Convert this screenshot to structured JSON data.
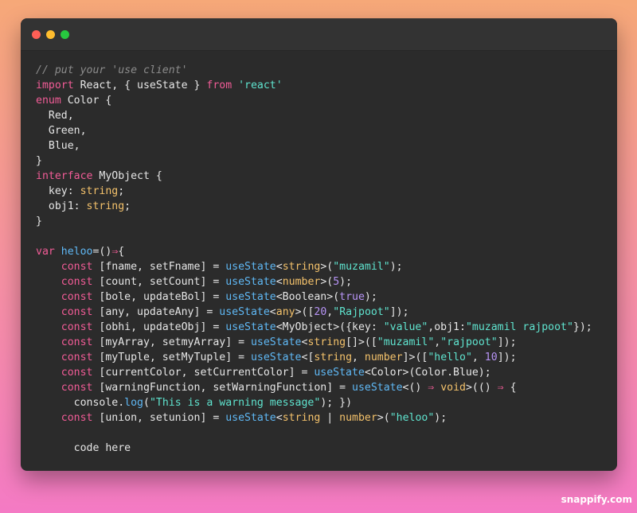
{
  "window": {
    "controls": [
      {
        "name": "close",
        "color": "#ff5f56"
      },
      {
        "name": "minimize",
        "color": "#ffbd2e"
      },
      {
        "name": "maximize",
        "color": "#27c93f"
      }
    ]
  },
  "code": {
    "lines": [
      [
        [
          "comment",
          "// put your 'use client'"
        ]
      ],
      [
        [
          "keyword",
          "import"
        ],
        [
          "plain",
          " React, { useState } "
        ],
        [
          "keyword",
          "from"
        ],
        [
          "plain",
          " "
        ],
        [
          "string",
          "'react'"
        ]
      ],
      [
        [
          "keyword",
          "enum"
        ],
        [
          "plain",
          " Color {"
        ]
      ],
      [
        [
          "plain",
          "  Red,"
        ]
      ],
      [
        [
          "plain",
          "  Green,"
        ]
      ],
      [
        [
          "plain",
          "  Blue,"
        ]
      ],
      [
        [
          "plain",
          "}"
        ]
      ],
      [
        [
          "keyword",
          "interface"
        ],
        [
          "plain",
          " MyObject {"
        ]
      ],
      [
        [
          "plain",
          "  key: "
        ],
        [
          "type",
          "string"
        ],
        [
          "plain",
          ";"
        ]
      ],
      [
        [
          "plain",
          "  obj1: "
        ],
        [
          "type",
          "string"
        ],
        [
          "plain",
          ";"
        ]
      ],
      [
        [
          "plain",
          "}"
        ]
      ],
      [],
      [
        [
          "keyword",
          "var"
        ],
        [
          "plain",
          " "
        ],
        [
          "func",
          "heloo"
        ],
        [
          "plain",
          "=()"
        ],
        [
          "keyword",
          "⇒"
        ],
        [
          "plain",
          "{"
        ]
      ],
      [
        [
          "plain",
          "    "
        ],
        [
          "keyword",
          "const"
        ],
        [
          "plain",
          " [fname, setFname] = "
        ],
        [
          "func",
          "useState"
        ],
        [
          "plain",
          "<"
        ],
        [
          "type",
          "string"
        ],
        [
          "plain",
          ">("
        ],
        [
          "string",
          "\"muzamil\""
        ],
        [
          "plain",
          ");"
        ]
      ],
      [
        [
          "plain",
          "    "
        ],
        [
          "keyword",
          "const"
        ],
        [
          "plain",
          " [count, setCount] = "
        ],
        [
          "func",
          "useState"
        ],
        [
          "plain",
          "<"
        ],
        [
          "type",
          "number"
        ],
        [
          "plain",
          ">("
        ],
        [
          "number",
          "5"
        ],
        [
          "plain",
          ");"
        ]
      ],
      [
        [
          "plain",
          "    "
        ],
        [
          "keyword",
          "const"
        ],
        [
          "plain",
          " [bole, updateBol] = "
        ],
        [
          "func",
          "useState"
        ],
        [
          "plain",
          "<Boolean>("
        ],
        [
          "const",
          "true"
        ],
        [
          "plain",
          ");"
        ]
      ],
      [
        [
          "plain",
          "    "
        ],
        [
          "keyword",
          "const"
        ],
        [
          "plain",
          " [any, updateAny] = "
        ],
        [
          "func",
          "useState"
        ],
        [
          "plain",
          "<"
        ],
        [
          "type",
          "any"
        ],
        [
          "plain",
          ">(["
        ],
        [
          "number",
          "20"
        ],
        [
          "plain",
          ","
        ],
        [
          "string",
          "\"Rajpoot\""
        ],
        [
          "plain",
          "]);"
        ]
      ],
      [
        [
          "plain",
          "    "
        ],
        [
          "keyword",
          "const"
        ],
        [
          "plain",
          " [obhi, updateObj] = "
        ],
        [
          "func",
          "useState"
        ],
        [
          "plain",
          "<MyObject>({key: "
        ],
        [
          "string",
          "\"value\""
        ],
        [
          "plain",
          ",obj1:"
        ],
        [
          "string",
          "\"muzamil rajpoot\""
        ],
        [
          "plain",
          "});"
        ]
      ],
      [
        [
          "plain",
          "    "
        ],
        [
          "keyword",
          "const"
        ],
        [
          "plain",
          " [myArray, setmyArray] = "
        ],
        [
          "func",
          "useState"
        ],
        [
          "plain",
          "<"
        ],
        [
          "type",
          "string"
        ],
        [
          "plain",
          "[]>(["
        ],
        [
          "string",
          "\"muzamil\""
        ],
        [
          "plain",
          ","
        ],
        [
          "string",
          "\"rajpoot\""
        ],
        [
          "plain",
          "]);"
        ]
      ],
      [
        [
          "plain",
          "    "
        ],
        [
          "keyword",
          "const"
        ],
        [
          "plain",
          " [myTuple, setMyTuple] = "
        ],
        [
          "func",
          "useState"
        ],
        [
          "plain",
          "<["
        ],
        [
          "type",
          "string"
        ],
        [
          "plain",
          ", "
        ],
        [
          "type",
          "number"
        ],
        [
          "plain",
          "]>(["
        ],
        [
          "string",
          "\"hello\""
        ],
        [
          "plain",
          ", "
        ],
        [
          "number",
          "10"
        ],
        [
          "plain",
          "]);"
        ]
      ],
      [
        [
          "plain",
          "    "
        ],
        [
          "keyword",
          "const"
        ],
        [
          "plain",
          " [currentColor, setCurrentColor] = "
        ],
        [
          "func",
          "useState"
        ],
        [
          "plain",
          "<Color>(Color.Blue);"
        ]
      ],
      [
        [
          "plain",
          "    "
        ],
        [
          "keyword",
          "const"
        ],
        [
          "plain",
          " [warningFunction, setWarningFunction] = "
        ],
        [
          "func",
          "useState"
        ],
        [
          "plain",
          "<() "
        ],
        [
          "keyword",
          "⇒"
        ],
        [
          "plain",
          " "
        ],
        [
          "type",
          "void"
        ],
        [
          "plain",
          ">(() "
        ],
        [
          "keyword",
          "⇒"
        ],
        [
          "plain",
          " {"
        ]
      ],
      [
        [
          "plain",
          "      console."
        ],
        [
          "func",
          "log"
        ],
        [
          "plain",
          "("
        ],
        [
          "string",
          "\"This is a warning message\""
        ],
        [
          "plain",
          "); })"
        ]
      ],
      [
        [
          "plain",
          "    "
        ],
        [
          "keyword",
          "const"
        ],
        [
          "plain",
          " [union, setunion] = "
        ],
        [
          "func",
          "useState"
        ],
        [
          "plain",
          "<"
        ],
        [
          "type",
          "string"
        ],
        [
          "plain",
          " | "
        ],
        [
          "type",
          "number"
        ],
        [
          "plain",
          ">("
        ],
        [
          "string",
          "\"heloo\""
        ],
        [
          "plain",
          ");"
        ]
      ],
      [],
      [
        [
          "plain",
          "      code here"
        ]
      ]
    ]
  },
  "watermark": "snappify.com"
}
